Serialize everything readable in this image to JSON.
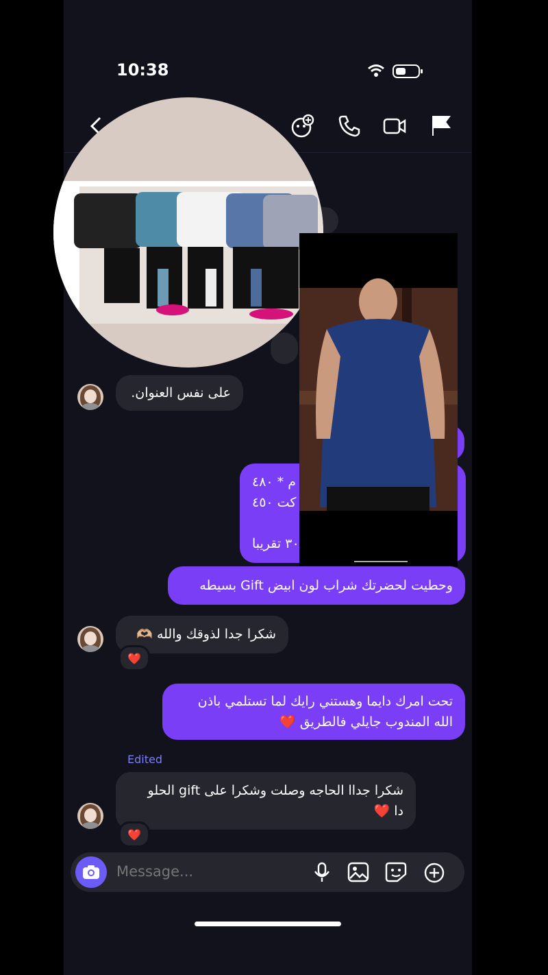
{
  "status": {
    "time": "10:38"
  },
  "header": {
    "icons": [
      "back-icon",
      "avatar-add-icon",
      "phone-icon",
      "video-icon",
      "flag-icon"
    ]
  },
  "messages": {
    "m1": {
      "text": "على نفس العنوان."
    },
    "m2": {
      "line1": "م  * ٤٨٠",
      "line2": "ي كت ٤٥٠",
      "line3": "٣٠ تقريبا"
    },
    "m3": {
      "text": "وحطيت لحضرتك شراب لون ابيض Gift بسيطه"
    },
    "m4": {
      "text": "شكرا جدا لذوقك والله 🫶🏼",
      "reaction": "❤️"
    },
    "m5": {
      "line1": "تحت امرك دايما وهستني رايك لما تستلمي باذن",
      "line2": "الله المندوب جايلي فالطريق ❤️"
    },
    "m6": {
      "edited": "Edited",
      "line1": "شكرا جداا الحاجه وصلت وشكرا على gift الحلو",
      "line2": "دا ❤️",
      "reaction": "❤️"
    }
  },
  "composer": {
    "placeholder": "Message..."
  },
  "colors": {
    "outgoing": "#7a3ef6",
    "incoming": "#26272e",
    "background": "#11121b",
    "accent": "#6b5cf7"
  }
}
